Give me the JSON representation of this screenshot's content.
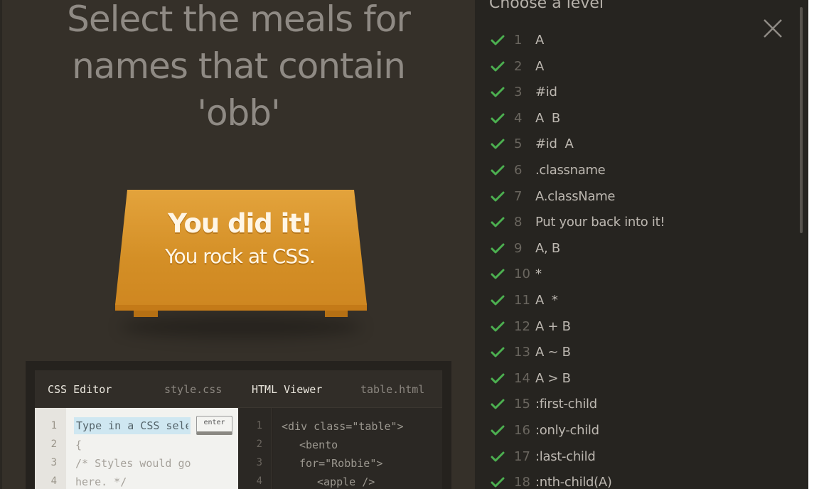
{
  "instruction": {
    "line1": "Select the meals for",
    "line2": "names that contain",
    "line3": "'obb'"
  },
  "win_message": {
    "title": "You did it!",
    "subtitle": "You rock at CSS."
  },
  "css_editor": {
    "title": "CSS Editor",
    "filename": "style.css",
    "input_placeholder": "Type in a CSS selector",
    "enter_label": "enter",
    "line_numbers": [
      "1",
      "2",
      "3",
      "4"
    ],
    "lines": [
      "{",
      "/* Styles would go",
      "here. */"
    ]
  },
  "html_viewer": {
    "title": "HTML Viewer",
    "filename": "table.html",
    "line_numbers": [
      "1",
      "2",
      "3",
      "4"
    ],
    "lines": [
      "<div class=\"table\">",
      "<bento",
      "for=\"Robbie\">",
      "<apple />"
    ]
  },
  "sidebar": {
    "title": "Choose a level",
    "check_color": "#4caf50",
    "levels": [
      {
        "num": "1",
        "name": "A"
      },
      {
        "num": "2",
        "name": "A"
      },
      {
        "num": "3",
        "name": "#id"
      },
      {
        "num": "4",
        "name": "A  B"
      },
      {
        "num": "5",
        "name": "#id  A"
      },
      {
        "num": "6",
        "name": ".classname"
      },
      {
        "num": "7",
        "name": "A.className"
      },
      {
        "num": "8",
        "name": "Put your back into it!"
      },
      {
        "num": "9",
        "name": "A, B"
      },
      {
        "num": "10",
        "name": "*"
      },
      {
        "num": "11",
        "name": "A  *"
      },
      {
        "num": "12",
        "name": "A + B"
      },
      {
        "num": "13",
        "name": "A ~ B"
      },
      {
        "num": "14",
        "name": "A > B"
      },
      {
        "num": "15",
        "name": ":first-child"
      },
      {
        "num": "16",
        "name": ":only-child"
      },
      {
        "num": "17",
        "name": ":last-child"
      },
      {
        "num": "18",
        "name": ":nth-child(A)"
      }
    ]
  }
}
